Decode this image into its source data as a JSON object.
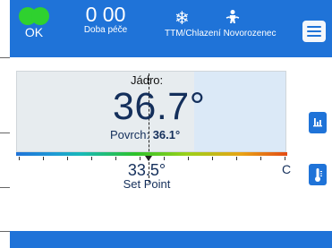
{
  "header": {
    "status": "OK",
    "time_value": "0 00",
    "time_label": "Doba péče",
    "mode_text": "TTM/Chlazení Novorozenec"
  },
  "main": {
    "core_label": "Jádro:",
    "core_value": "36.7°",
    "surface_label": "Povrch:",
    "surface_value": "36.1°",
    "setpoint_value": "33.5°",
    "setpoint_label": "Set Point",
    "unit": "C"
  },
  "icons": {
    "status": "status-ok-icon",
    "mode": "snowflake-icon",
    "patient": "baby-icon",
    "menu": "hamburger-menu-icon",
    "chart": "bar-chart-icon",
    "thermometer": "thermometer-icon"
  },
  "colors": {
    "header_blue": "#1f73d8",
    "ok_green": "#2fd12f",
    "text_dark_blue": "#142f5b",
    "panel_gray": "#e7ecef",
    "panel_blue": "#dbe9f7"
  }
}
